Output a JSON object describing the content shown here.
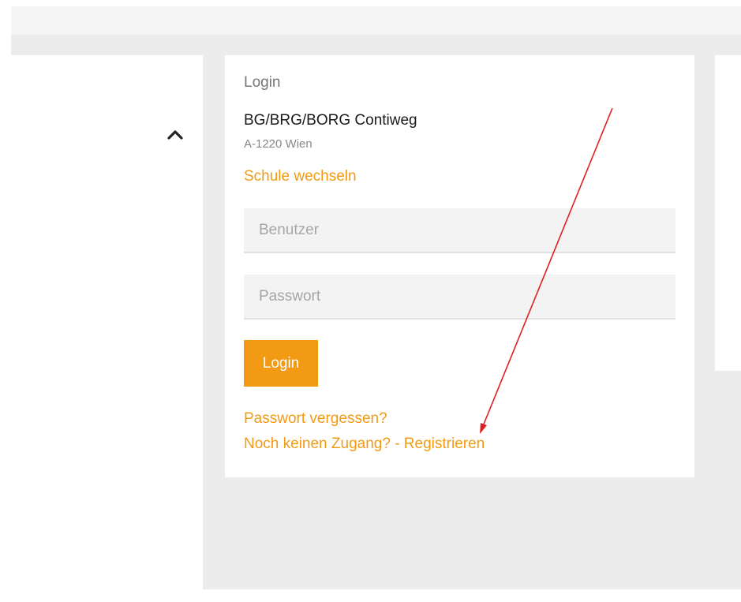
{
  "login_card": {
    "title": "Login",
    "school_name": "BG/BRG/BORG Contiweg",
    "school_address": "A-1220 Wien",
    "change_school_label": "Schule wechseln",
    "username_placeholder": "Benutzer",
    "password_placeholder": "Passwort",
    "login_button_label": "Login",
    "forgot_password_label": "Passwort vergessen?",
    "no_access_label": "Noch keinen Zugang? - Registrieren"
  },
  "colors": {
    "accent": "#f39a14",
    "annotation_arrow": "#e02020"
  },
  "icons": {
    "collapse": "chevron-up-icon"
  }
}
